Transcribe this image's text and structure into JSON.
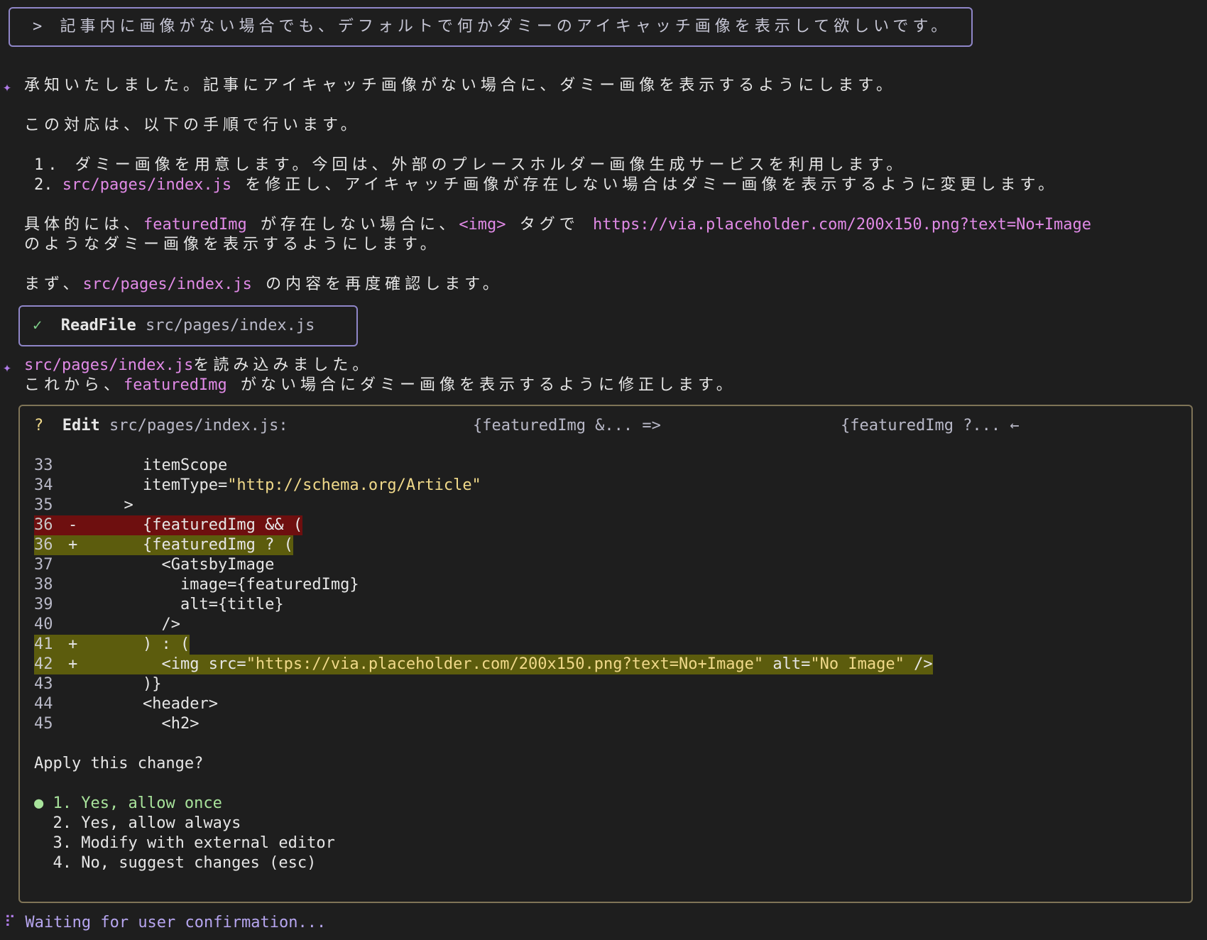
{
  "prompt": {
    "text": "> 記事内に画像がない場合でも、デフォルトで何かダミーのアイキャッチ画像を表示して欲しいです。"
  },
  "assistant1": {
    "line1": "承知いたしました。記事にアイキャッチ画像がない場合に、ダミー画像を表示するようにします。",
    "line2": "この対応は、以下の手順で行います。",
    "step1": "1. ダミー画像を用意します。今回は、外部のプレースホルダー画像生成サービスを利用します。",
    "step2_num": "2. ",
    "step2_code": "src/pages/index.js",
    "step2_text": " を修正し、アイキャッチ画像が存在しない場合はダミー画像を表示するように変更します。",
    "detail_a": "具体的には、",
    "detail_code1": "featuredImg",
    "detail_b": " が存在しない場合に、",
    "detail_code2": "<img>",
    "detail_c": " タグで ",
    "detail_url": "https://via.placeholder.com/200x150.png?text=No+Image",
    "detail_line2": "のようなダミー画像を表示するようにします。",
    "first_a": "まず、",
    "first_code": "src/pages/index.js",
    "first_b": " の内容を再度確認します。"
  },
  "tool": {
    "check": "✓",
    "name": "ReadFile",
    "path": "src/pages/index.js"
  },
  "assistant2": {
    "code": "src/pages/index.js",
    "line1_rest": "を読み込みました。",
    "line2_a": "これから、",
    "line2_code": "featuredImg",
    "line2_b": " がない場合にダミー画像を表示するように修正します。"
  },
  "edit": {
    "q": "?",
    "label": "Edit",
    "file": "src/pages/index.js:",
    "old": "{featuredImg &... =>",
    "new": "{featuredImg ?... ←",
    "lines": [
      {
        "n": "33",
        "s": "",
        "code": "    itemScope"
      },
      {
        "n": "34",
        "s": "",
        "pre": "    itemType=",
        "str": "\"http://schema.org/Article\""
      },
      {
        "n": "35",
        "s": "",
        "code": "  >"
      },
      {
        "n": "36",
        "s": "-",
        "code": "    {featuredImg && ("
      },
      {
        "n": "36",
        "s": "+",
        "code": "    {featuredImg ? ("
      },
      {
        "n": "37",
        "s": "",
        "code": "      <GatsbyImage"
      },
      {
        "n": "38",
        "s": "",
        "code": "        image={featuredImg}"
      },
      {
        "n": "39",
        "s": "",
        "code": "        alt={title}"
      },
      {
        "n": "40",
        "s": "",
        "code": "      />"
      },
      {
        "n": "41",
        "s": "+",
        "code": "    ) : ("
      },
      {
        "n": "42",
        "s": "+",
        "pre": "      <img src=",
        "str": "\"https://via.placeholder.com/200x150.png?text=No+Image\"",
        "mid": " alt=",
        "str2": "\"No Image\"",
        "post": " />"
      },
      {
        "n": "43",
        "s": "",
        "code": "    )}"
      },
      {
        "n": "44",
        "s": "",
        "code": "    <header>"
      },
      {
        "n": "45",
        "s": "",
        "code": "      <h2>"
      }
    ],
    "question": "Apply this change?",
    "options": [
      "1. Yes, allow once",
      "2. Yes, allow always",
      "3. Modify with external editor",
      "4. No, suggest changes (esc)"
    ]
  },
  "status": {
    "spinner": "⠏",
    "text": "Waiting for user confirmation..."
  }
}
